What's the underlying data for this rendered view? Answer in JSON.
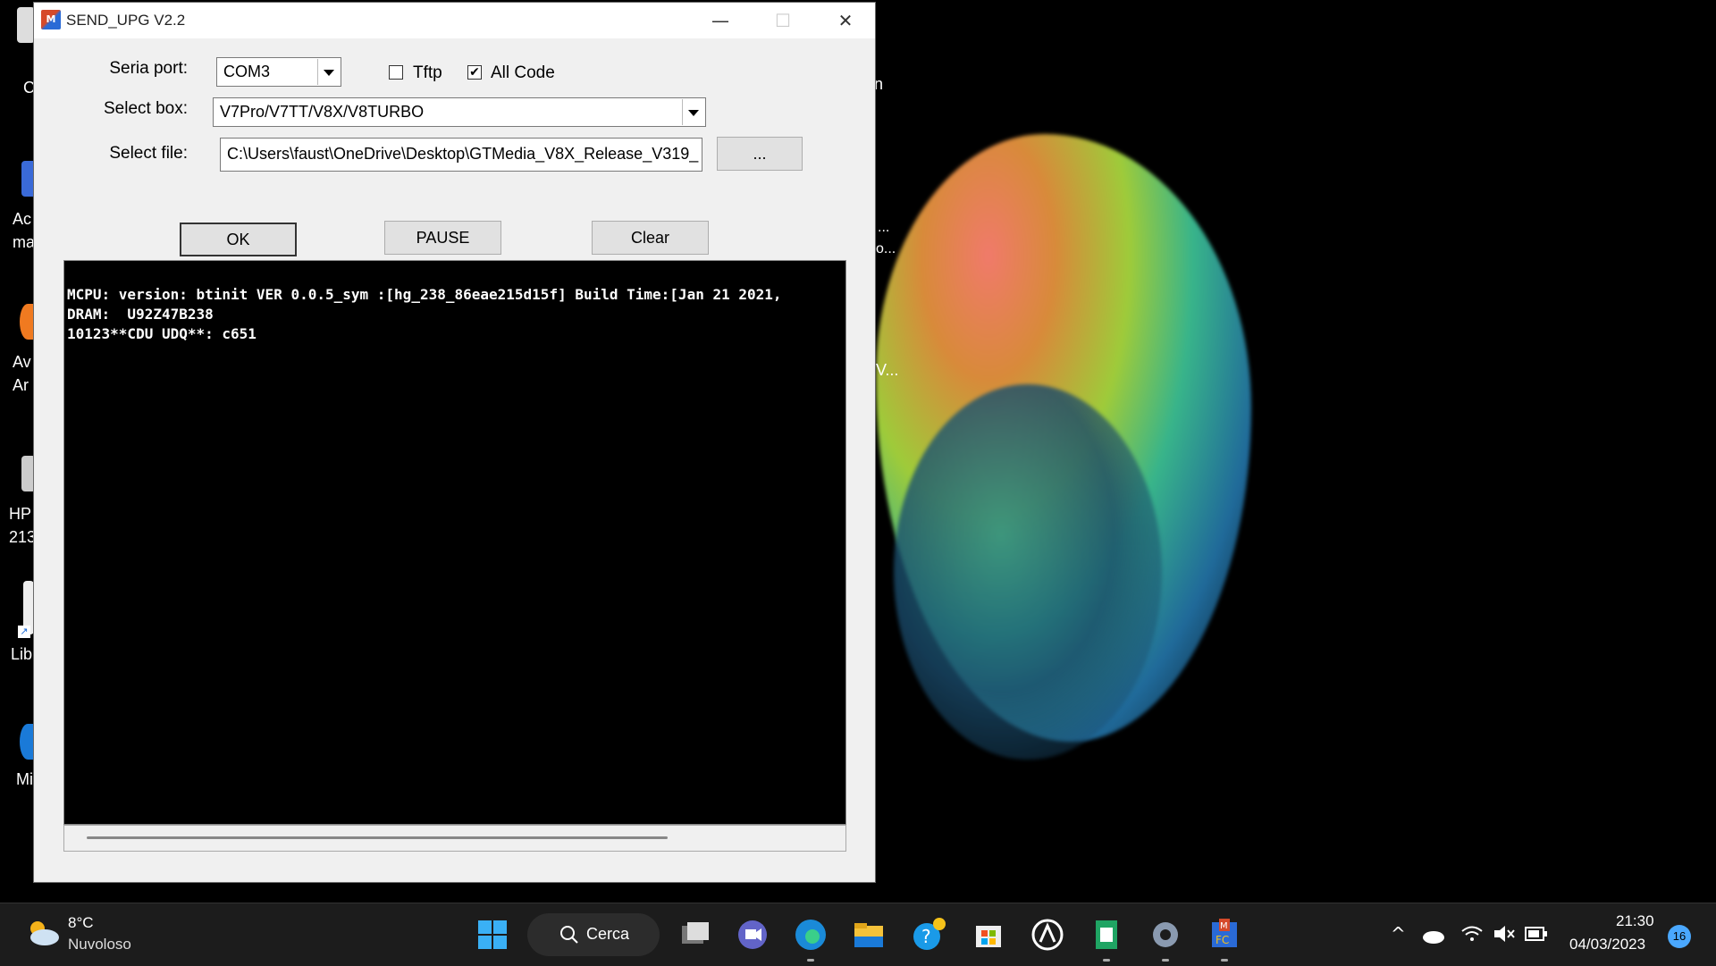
{
  "window": {
    "title": "SEND_UPG V2.2",
    "app_icon_letter": "M",
    "minimize": "—",
    "maximize": "☐",
    "close": "✕"
  },
  "form": {
    "serial_port_label": "Seria port:",
    "serial_port_value": "COM3",
    "tftp_label": "Tftp",
    "tftp_checked": false,
    "all_code_label": "All Code",
    "all_code_checked": true,
    "select_box_label": "Select box:",
    "select_box_value": "V7Pro/V7TT/V8X/V8TURBO",
    "select_file_label": "Select file:",
    "select_file_value": "C:\\Users\\faust\\OneDrive\\Desktop\\GTMedia_V8X_Release_V319_",
    "browse_label": "...",
    "ok_label": "OK",
    "pause_label": "PAUSE",
    "clear_label": "Clear"
  },
  "console": {
    "lines": [
      "MCPU: version: btinit VER 0.0.5_sym :[hg_238_86eae215d15f] Build Time:[Jan 21 2021,",
      "DRAM:  U92Z47B238",
      "10123**CDU UDQ**: c651"
    ]
  },
  "desktop_icons": [
    {
      "label": "C"
    },
    {
      "label": "Ac\nma"
    },
    {
      "label": "Av\nAr"
    },
    {
      "label": "HP\n213"
    },
    {
      "label": "Lib"
    },
    {
      "label": "Mi"
    }
  ],
  "behind_window_fragments": [
    "n",
    "...",
    "o...",
    "V..."
  ],
  "taskbar": {
    "weather_temp": "8°C",
    "weather_desc": "Nuvoloso",
    "search_label": "Cerca",
    "apps": [
      "windows-start-icon",
      "task-view-icon",
      "teams-chat-icon",
      "edge-icon",
      "file-explorer-icon",
      "help-icon",
      "store-icon",
      "app-icon",
      "sheets-icon",
      "settings-icon",
      "send-upg-icon"
    ],
    "clock_time": "21:30",
    "clock_date": "04/03/2023",
    "notification_count": "16"
  }
}
